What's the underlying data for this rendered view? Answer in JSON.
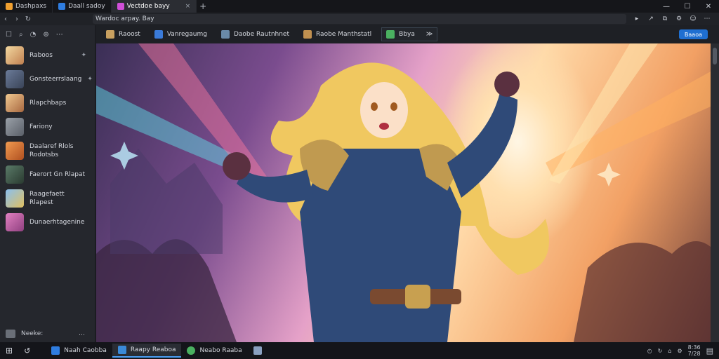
{
  "titlebar": {
    "tabs": [
      {
        "label": "Dashpaxs",
        "color": "#f0a030"
      },
      {
        "label": "Daall sadoy",
        "color": "#2f7de0"
      },
      {
        "label": "Vectdoe bayy",
        "color": "#d04fd8",
        "active": true
      }
    ],
    "close": "×",
    "newtab": "+",
    "min": "—",
    "max": "☐",
    "winclose": "✕"
  },
  "navbar": {
    "back": "‹",
    "forward": "›",
    "reload": "↻",
    "address": "Wardoc arpay. Bay",
    "icons": [
      "▸",
      "↗",
      "⧉",
      "⚙",
      "☺",
      "⋯"
    ]
  },
  "sidebar": {
    "tools": [
      "☐",
      "⌕",
      "◔",
      "⊕",
      "⋯"
    ],
    "items": [
      {
        "label": "Raboos",
        "color": "#e8c080",
        "pin": "✦"
      },
      {
        "label": "Gonsteerrslaang",
        "color": "#5a6a88",
        "pin": "✦"
      },
      {
        "label": "Rlapchbaps",
        "color": "#d8b080"
      },
      {
        "label": "Fariony",
        "color": "#7a7f88"
      },
      {
        "label": "Daalaref Rlols",
        "label2": "Rodotsbs",
        "color": "#e07a40"
      },
      {
        "label": "Faerort Gn Rlapat",
        "color": "#4a6a58"
      },
      {
        "label": "Raagefaett",
        "label2": "Rlapest",
        "color": "#6aa0d8"
      },
      {
        "label": "Dunaerhtagenine",
        "color": "#c060a0"
      }
    ],
    "bottom_label": "Neeke:",
    "bottom_more": "…"
  },
  "toolbar": {
    "items": [
      {
        "label": "Raoost",
        "color": "#c8a060"
      },
      {
        "label": "Vanregaumg",
        "color": "#3a7ad8"
      },
      {
        "label": "Daobe Rautnhnet",
        "color": "#6a8aa8"
      },
      {
        "label": "Raobe Manthstatl",
        "color": "#c09050"
      },
      {
        "label": "Bbya",
        "color": "#4ab060",
        "extra": "≫",
        "boxed": true
      }
    ],
    "button": "Baaoa"
  },
  "taskbar": {
    "start": "⊞",
    "search": "↺",
    "items": [
      {
        "label": "Naah Caobba",
        "color": "#2f7de0"
      },
      {
        "label": "Raapy Reaboa",
        "color": "#3a8ad8",
        "active": true
      },
      {
        "label": "Neabo Raaba",
        "color": "#4ab060"
      },
      {
        "label": "",
        "color": "#8aa0c0"
      }
    ],
    "tray": [
      "◴",
      "↻",
      "⌂",
      "⚙"
    ],
    "clock_top": "8:36",
    "clock_bottom": "7/28",
    "notify": "▤"
  }
}
